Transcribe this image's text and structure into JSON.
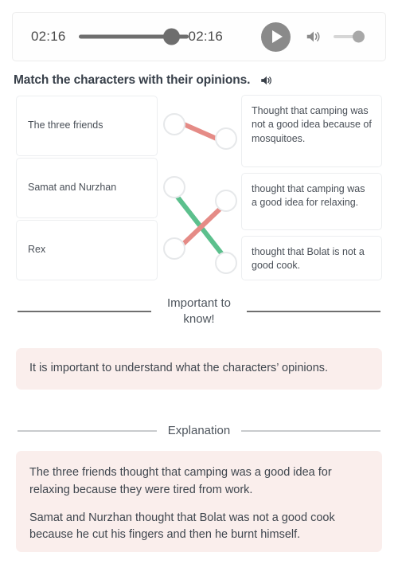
{
  "audio_player": {
    "current_time": "02:16",
    "total_time": "02:16",
    "progress_percent": 100,
    "volume_percent": 80,
    "play_icon": "play-icon",
    "volume_icon": "volume-high-icon",
    "state": "paused"
  },
  "question": {
    "title": "Match the characters with their opinions.",
    "speaker_icon": "speaker-icon"
  },
  "matching": {
    "left_items": [
      {
        "id": "L1",
        "label": "The three friends"
      },
      {
        "id": "L2",
        "label": "Samat and Nurzhan"
      },
      {
        "id": "L3",
        "label": "Rex"
      }
    ],
    "right_items": [
      {
        "id": "R1",
        "label": "Thought that camping was not a good idea because of mosquitoes."
      },
      {
        "id": "R2",
        "label": "thought that camping was a good idea for relaxing."
      },
      {
        "id": "R3",
        "label": "thought that Bolat is not a good cook."
      }
    ],
    "connections": [
      {
        "from": "L1",
        "to": "R1",
        "color": "#e58b86",
        "status": "incorrect"
      },
      {
        "from": "L2",
        "to": "R3",
        "color": "#5cc08d",
        "status": "correct"
      },
      {
        "from": "L3",
        "to": "R2",
        "color": "#e58b86",
        "status": "incorrect"
      }
    ],
    "colors": {
      "correct": "#5cc08d",
      "incorrect": "#e58b86",
      "node_border": "#e6e8ea",
      "box_border": "#eceef0"
    }
  },
  "important_section": {
    "divider_label": "Important to know!",
    "body": "It is important to understand what the characters’ opinions."
  },
  "explanation_section": {
    "divider_label": "Explanation",
    "paragraphs": [
      "The three friends thought that camping was a good idea for relaxing because they were tired from work.",
      "Samat and Nurzhan thought that Bolat was not a good cook because he cut his fingers and then he burnt himself."
    ]
  },
  "theme": {
    "panel_background": "#faeeec",
    "page_background": "#ffffff",
    "text_color": "#3f464e",
    "player_gray": "#6e6e6e"
  }
}
